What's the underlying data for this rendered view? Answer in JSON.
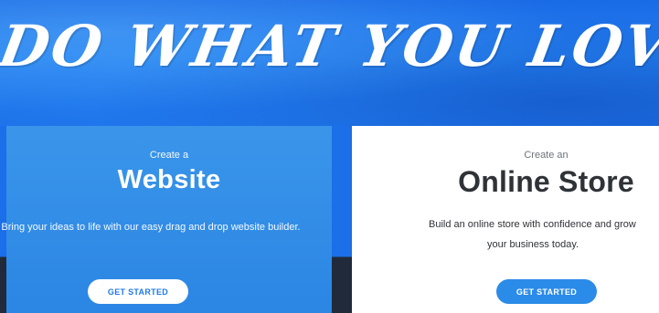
{
  "hero": {
    "title": "DO WHAT YOU LOVE",
    "background_color": "#1a6ae6"
  },
  "cards": {
    "website": {
      "eyebrow": "Create a",
      "heading": "Website",
      "description": "Bring your ideas to life with our easy drag and drop website builder.",
      "button_label": "GET STARTED",
      "background_color": "#2b86e4"
    },
    "store": {
      "eyebrow": "Create an",
      "heading": "Online Store",
      "description_line1": "Build an online store with confidence and grow",
      "description_line2": "your business today.",
      "button_label": "GET STARTED",
      "button_color": "#2b8be8"
    }
  }
}
